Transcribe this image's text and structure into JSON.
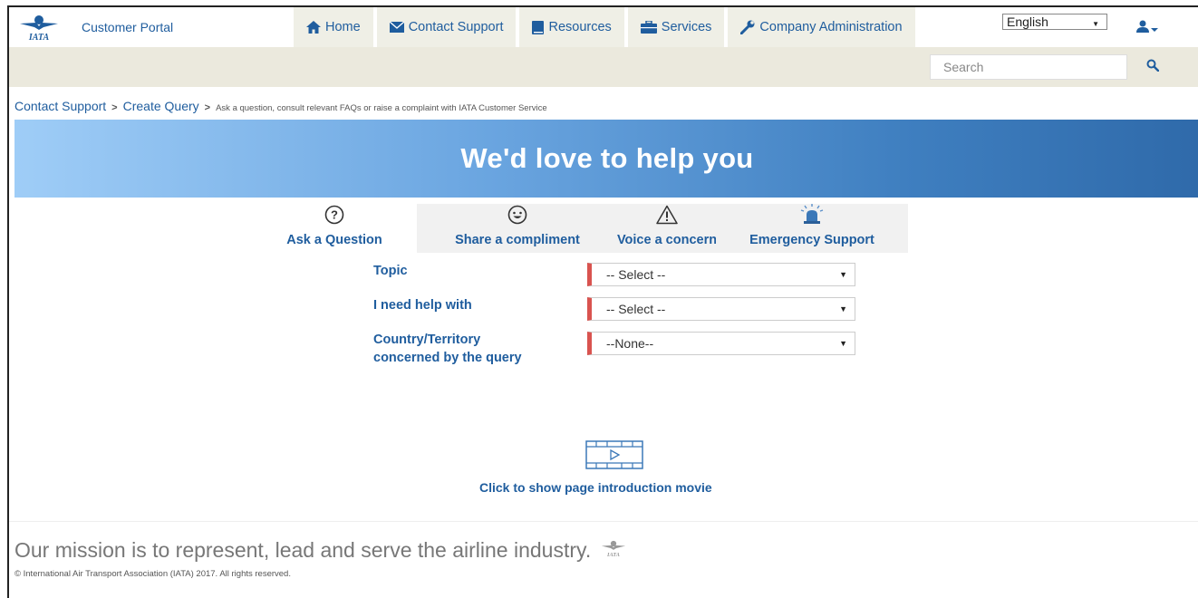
{
  "header": {
    "logo_text": "IATA",
    "portal_title": "Customer Portal",
    "nav": [
      {
        "label": "Home",
        "icon": "home-icon"
      },
      {
        "label": "Contact Support",
        "icon": "envelope-icon"
      },
      {
        "label": "Resources",
        "icon": "book-icon"
      },
      {
        "label": "Services",
        "icon": "briefcase-icon"
      },
      {
        "label": "Company Administration",
        "icon": "wrench-icon"
      }
    ],
    "language": "English",
    "user_icon": "user-icon"
  },
  "search": {
    "placeholder": "Search",
    "icon": "search-icon"
  },
  "breadcrumb": {
    "items": [
      "Contact Support",
      "Create Query"
    ],
    "description": "Ask a question, consult relevant FAQs or raise a complaint with IATA Customer Service"
  },
  "hero": {
    "title": "We'd love to help you"
  },
  "tabs": [
    {
      "label": "Ask a Question",
      "icon": "question-circle-icon"
    },
    {
      "label": "Share a compliment",
      "icon": "smiley-icon"
    },
    {
      "label": "Voice a concern",
      "icon": "warning-icon"
    },
    {
      "label": "Emergency Support",
      "icon": "siren-icon"
    }
  ],
  "form": {
    "fields": [
      {
        "label": "Topic",
        "value": "-- Select --"
      },
      {
        "label": "I need help with",
        "value": "-- Select --"
      },
      {
        "label": "Country/Territory concerned by the query",
        "value": "--None--"
      }
    ]
  },
  "movie": {
    "label": "Click to show page introduction movie",
    "icon": "film-play-icon"
  },
  "footer": {
    "mission": "Our mission is to represent, lead and serve the airline industry.",
    "copyright": "© International Air Transport Association (IATA) 2017. All rights reserved."
  },
  "colors": {
    "link": "#1f5d9e",
    "required": "#d9534f",
    "nav_bg": "#efefe6",
    "band_bg": "#ebe9dd"
  }
}
